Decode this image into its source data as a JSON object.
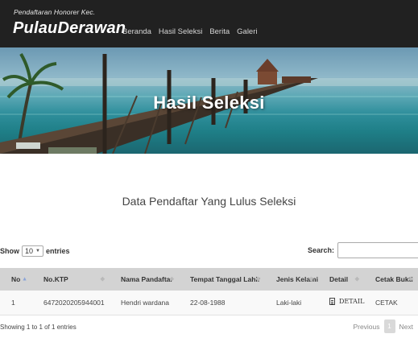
{
  "brand": {
    "subtitle": "Pendaftaran Honorer Kec.",
    "title": "PulauDerawan"
  },
  "nav": [
    "Beranda",
    "Hasil Seleksi",
    "Berita",
    "Galeri"
  ],
  "hero": {
    "title": "Hasil Seleksi"
  },
  "section_title": "Data Pendaftar Yang Lulus Seleksi",
  "length_control": {
    "prefix": "Show",
    "value": "10",
    "suffix": "entries"
  },
  "search": {
    "label": "Search:",
    "value": "",
    "placeholder": ""
  },
  "table": {
    "columns": [
      "No",
      "No.KTP",
      "Nama Pandaftar",
      "Tempat Tanggal Lahir",
      "Jenis Kelamin",
      "Detail",
      "Cetak Bukti"
    ],
    "rows": [
      {
        "no": "1",
        "ktp": "6472020205944001",
        "nama": "Hendri wardana",
        "ttl": "22-08-1988",
        "jk": "Laki-laki",
        "detail": "DETAIL",
        "cetak": "CETAK"
      }
    ]
  },
  "info": "Showing 1 to 1 of 1 entries",
  "pagination": {
    "previous": "Previous",
    "current": "1",
    "next": "Next"
  },
  "icons": {
    "detail": "document-icon"
  },
  "colors": {
    "navbar": "#212121",
    "table_header": "#d3d3d3",
    "pager_current": "#d9d9d9"
  }
}
